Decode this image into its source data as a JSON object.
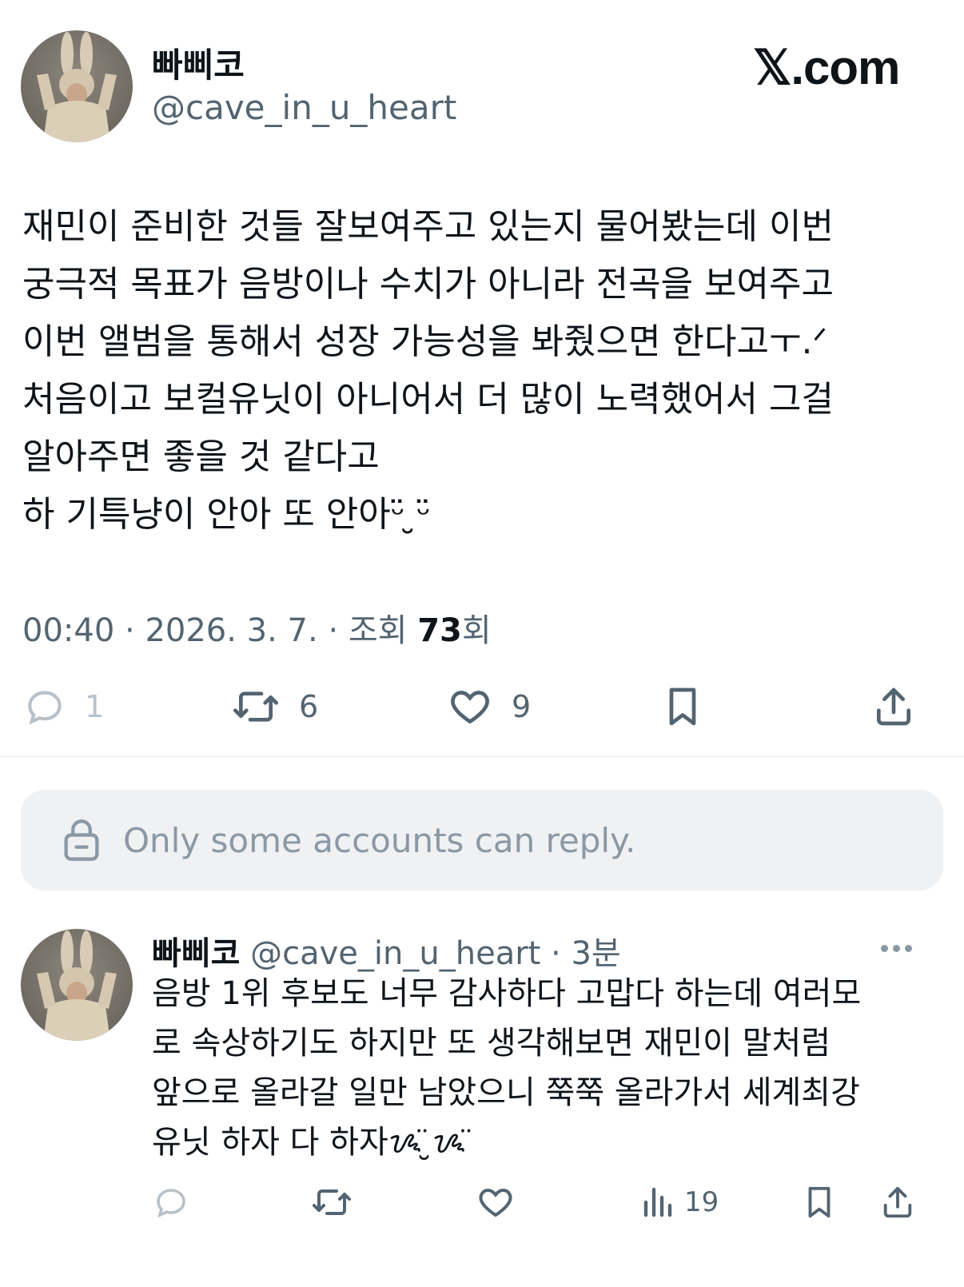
{
  "brand": {
    "logo_text": "𝕏.com"
  },
  "post": {
    "author_name": "빠삐코",
    "author_handle": "@cave_in_u_heart",
    "text": "재민이 준비한 것들 잘보여주고 있는지 물어봤는데 이번\n궁극적 목표가 음방이나 수치가 아니라 전곡을 보여주고\n이번 앨범을 통해서 성장 가능성을 봐줬으면 한다고ㅜ.ᐟ\n처음이고 보컬유닛이 아니어서 더 많이 노력했어서 그걸\n알아주면 좋을 것 같다고\n하 기특냥이 안아 또 안아ᵕ̈ ̮ᵕ̈",
    "time": "00:40",
    "date": "2026. 3. 7.",
    "views_label": "조회",
    "views_count": "73",
    "views_suffix": "회",
    "replies": "1",
    "reposts": "6",
    "likes": "9"
  },
  "reply_notice": "Only some accounts can reply.",
  "reply": {
    "author_name": "빠삐코",
    "author_handle": "@cave_in_u_heart",
    "time": "3분",
    "text": "음방 1위 후보도 너무 감사하다 고맙다 하는데 여러모\n로 속상하기도 하지만 또 생각해보면 재민이 말처럼\n앞으로 올라갈 일만 남았으니 쭉쭉 올라가서 세계최강\n유닛 하자 다 하자ᝰ̈ ̮ᝰ̈",
    "views": "19"
  },
  "icons": [
    "reply-icon",
    "repost-icon",
    "like-icon",
    "bookmark-icon",
    "share-icon",
    "lock-icon",
    "views-icon",
    "more-icon"
  ],
  "colors": {
    "text": "#0f1419",
    "muted": "#536471",
    "reply_box": "#eff1f3"
  }
}
